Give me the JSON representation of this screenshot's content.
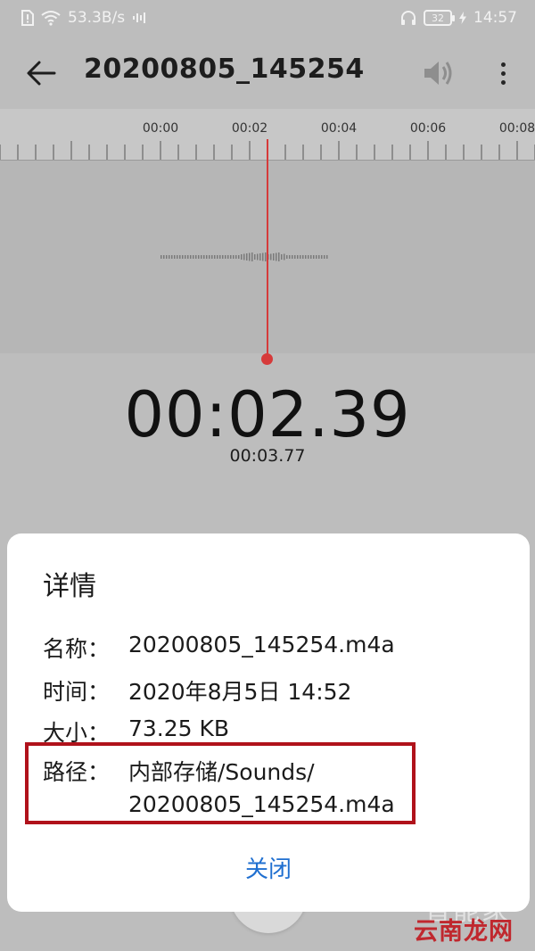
{
  "status_bar": {
    "net_speed": "53.3B/s",
    "battery": "32",
    "clock": "14:57"
  },
  "app_bar": {
    "title": "20200805_145254"
  },
  "timeline": {
    "ticks": [
      "00:00",
      "00:02",
      "00:04",
      "00:06",
      "00:08"
    ]
  },
  "playback": {
    "current_time": "00:02.39",
    "total_time": "00:03.77"
  },
  "dialog": {
    "title": "详情",
    "rows": [
      {
        "label": "名称：",
        "value": "20200805_145254.m4a"
      },
      {
        "label": "时间：",
        "value": "2020年8月5日 14:52"
      },
      {
        "label": "大小：",
        "value": "73.25 KB"
      },
      {
        "label": "路径：",
        "value_line1": "内部存储/Sounds/",
        "value_line2": "20200805_145254.m4a"
      }
    ],
    "close_label": "关闭"
  },
  "watermark": {
    "light_text": "智能家",
    "main_text": "云南龙网"
  },
  "colors": {
    "accent_blue": "#1f6fd0",
    "playhead_red": "#d63a3a",
    "highlight_red": "#b0121b"
  }
}
